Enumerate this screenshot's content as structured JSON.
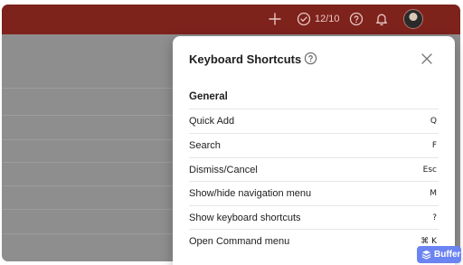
{
  "topbar": {
    "karma_count": "12/10",
    "icons": [
      "add-icon",
      "karma-check-icon",
      "help-icon",
      "bell-icon"
    ],
    "colors": {
      "background": "#7e221c",
      "icon": "#e8c7c3"
    }
  },
  "modal": {
    "title": "Keyboard Shortcuts",
    "section": "General",
    "rows": [
      {
        "label": "Quick Add",
        "key": "Q"
      },
      {
        "label": "Search",
        "key": "F"
      },
      {
        "label": "Dismiss/Cancel",
        "key": "Esc"
      },
      {
        "label": "Show/hide navigation menu",
        "key": "M"
      },
      {
        "label": "Show keyboard shortcuts",
        "key": "?"
      },
      {
        "label": "Open Command menu",
        "key": "⌘ K"
      }
    ]
  },
  "badge": {
    "label": "Buffer",
    "color": "#6b84f2"
  }
}
